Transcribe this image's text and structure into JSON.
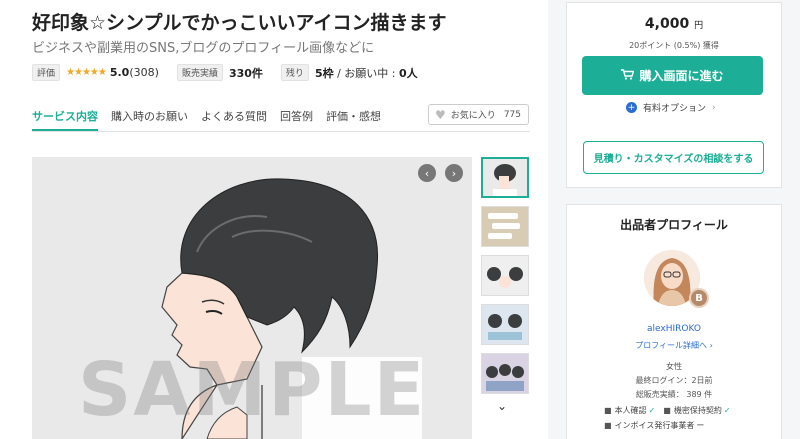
{
  "listing": {
    "title": "好印象☆シンプルでかっこいいアイコン描きます",
    "subtitle": "ビジネスや副業用のSNS,ブログのプロフィール画像などに"
  },
  "stats": {
    "rating_label": "評価",
    "stars": "★★★★★",
    "rating_value": "5.0",
    "rating_count": "(308)",
    "sales_label": "販売実績",
    "sales_value": "330件",
    "remaining_label": "残り",
    "remaining_value": "5枠",
    "in_progress_text": " / お願い中 : ",
    "in_progress_value": "0人"
  },
  "tabs": [
    "サービス内容",
    "購入時のお願い",
    "よくある質問",
    "回答例",
    "評価・感想"
  ],
  "favorite": {
    "label": "お気に入り",
    "count": "775"
  },
  "gallery": {
    "watermark": "SAMPLE",
    "prev_icon": "‹",
    "next_icon": "›",
    "down_icon": "⌄"
  },
  "purchase": {
    "price": "4,000",
    "currency": "円",
    "points": "20ポイント (0.5%) 獲得",
    "buy_label": "購入画面に進む",
    "option_label": "有料オプション",
    "quote_label": "見積り・カスタマイズの相談をする"
  },
  "profile": {
    "heading": "出品者プロフィール",
    "rank": "B",
    "name": "alexHIROKO",
    "link": "プロフィール詳細へ",
    "gender": "女性",
    "last_login": "最終ログイン：2日前",
    "total_sales": "総販売実績： 389 件",
    "id_verified": "本人確認",
    "nda": "機密保持契約",
    "invoice": "インボイス発行事業者"
  },
  "colors": {
    "accent": "#1cae96",
    "link": "#2b6cd6",
    "star": "#f5a623"
  }
}
